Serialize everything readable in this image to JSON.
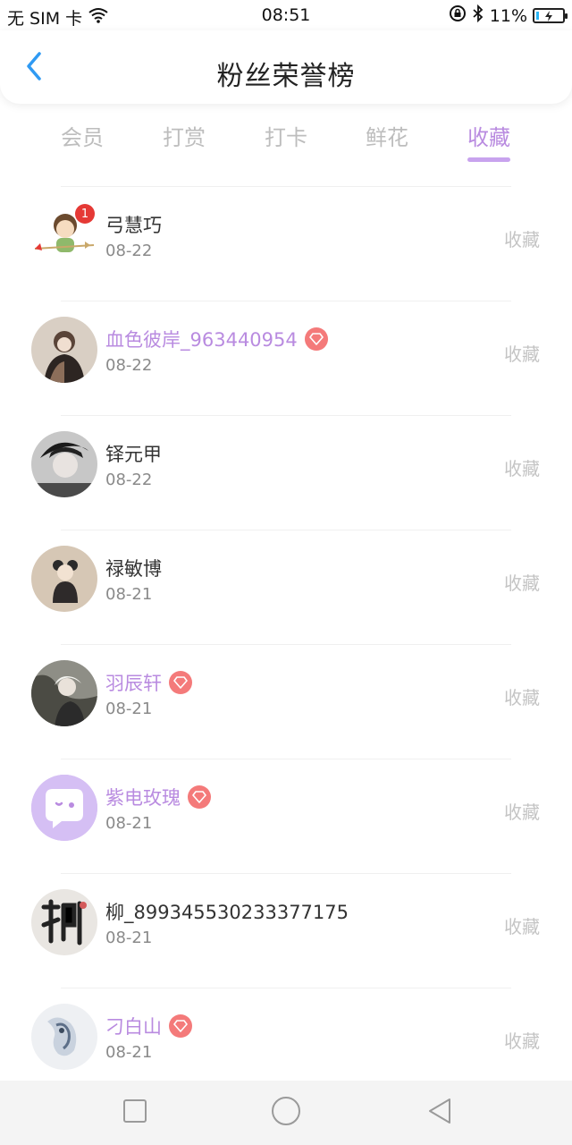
{
  "status_bar": {
    "carrier": "无 SIM 卡",
    "time": "08:51",
    "battery": "11%",
    "battery_level": 0.11
  },
  "header": {
    "title": "粉丝荣誉榜",
    "back_icon": "chevron-left-icon"
  },
  "tabs": [
    {
      "label": "会员",
      "active": false
    },
    {
      "label": "打赏",
      "active": false
    },
    {
      "label": "打卡",
      "active": false
    },
    {
      "label": "鲜花",
      "active": false
    },
    {
      "label": "收藏",
      "active": true
    }
  ],
  "list": [
    {
      "name": "弓慧巧",
      "date": "08-22",
      "action": "收藏",
      "vip": false,
      "rank_badge": "1"
    },
    {
      "name": "血色彼岸_963440954",
      "date": "08-22",
      "action": "收藏",
      "vip": true
    },
    {
      "name": "铎元甲",
      "date": "08-22",
      "action": "收藏",
      "vip": false
    },
    {
      "name": "禄敏博",
      "date": "08-21",
      "action": "收藏",
      "vip": false
    },
    {
      "name": "羽辰轩",
      "date": "08-21",
      "action": "收藏",
      "vip": true
    },
    {
      "name": "紫电玫瑰",
      "date": "08-21",
      "action": "收藏",
      "vip": true
    },
    {
      "name": "柳_899345530233377175",
      "date": "08-21",
      "action": "收藏",
      "vip": false
    },
    {
      "name": "刁白山",
      "date": "08-21",
      "action": "收藏",
      "vip": true
    }
  ],
  "colors": {
    "accent": "#b98be0",
    "vip_badge": "#f47a7a",
    "muted": "#c4c4c4",
    "back_icon": "#2f9af3"
  },
  "bottom_nav": {
    "icons": [
      "square-icon",
      "circle-home-icon",
      "triangle-back-icon"
    ]
  }
}
